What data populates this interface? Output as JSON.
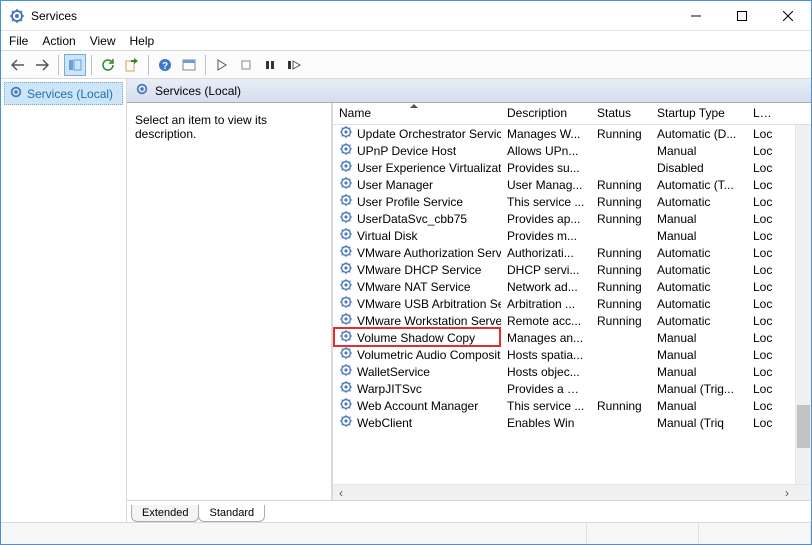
{
  "window": {
    "title": "Services"
  },
  "menu": {
    "file": "File",
    "action": "Action",
    "view": "View",
    "help": "Help"
  },
  "nav": {
    "root": "Services (Local)"
  },
  "pane": {
    "header": "Services (Local)",
    "desc_prompt": "Select an item to view its description."
  },
  "columns": {
    "name": "Name",
    "description": "Description",
    "status": "Status",
    "startup": "Startup Type",
    "logon": "Log"
  },
  "tabs": {
    "extended": "Extended",
    "standard": "Standard"
  },
  "highlight_index": 14,
  "services": [
    {
      "name": "Update Orchestrator Service",
      "desc": "Manages W...",
      "status": "Running",
      "startup": "Automatic (D...",
      "logon": "Loc"
    },
    {
      "name": "UPnP Device Host",
      "desc": "Allows UPn...",
      "status": "",
      "startup": "Manual",
      "logon": "Loc"
    },
    {
      "name": "User Experience Virtualizatio...",
      "desc": "Provides su...",
      "status": "",
      "startup": "Disabled",
      "logon": "Loc"
    },
    {
      "name": "User Manager",
      "desc": "User Manag...",
      "status": "Running",
      "startup": "Automatic (T...",
      "logon": "Loc"
    },
    {
      "name": "User Profile Service",
      "desc": "This service ...",
      "status": "Running",
      "startup": "Automatic",
      "logon": "Loc"
    },
    {
      "name": "UserDataSvc_cbb75",
      "desc": "Provides ap...",
      "status": "Running",
      "startup": "Manual",
      "logon": "Loc"
    },
    {
      "name": "Virtual Disk",
      "desc": "Provides m...",
      "status": "",
      "startup": "Manual",
      "logon": "Loc"
    },
    {
      "name": "VMware Authorization Servi...",
      "desc": "Authorizati...",
      "status": "Running",
      "startup": "Automatic",
      "logon": "Loc"
    },
    {
      "name": "VMware DHCP Service",
      "desc": "DHCP servi...",
      "status": "Running",
      "startup": "Automatic",
      "logon": "Loc"
    },
    {
      "name": "VMware NAT Service",
      "desc": "Network ad...",
      "status": "Running",
      "startup": "Automatic",
      "logon": "Loc"
    },
    {
      "name": "VMware USB Arbitration Ser...",
      "desc": "Arbitration ...",
      "status": "Running",
      "startup": "Automatic",
      "logon": "Loc"
    },
    {
      "name": "VMware Workstation Server",
      "desc": "Remote acc...",
      "status": "Running",
      "startup": "Automatic",
      "logon": "Loc"
    },
    {
      "name": "Volume Shadow Copy",
      "desc": "Manages an...",
      "status": "",
      "startup": "Manual",
      "logon": "Loc"
    },
    {
      "name": "Volumetric Audio Composit...",
      "desc": "Hosts spatia...",
      "status": "",
      "startup": "Manual",
      "logon": "Loc"
    },
    {
      "name": "WalletService",
      "desc": "Hosts objec...",
      "status": "",
      "startup": "Manual",
      "logon": "Loc"
    },
    {
      "name": "WarpJITSvc",
      "desc": "Provides a JI...",
      "status": "",
      "startup": "Manual (Trig...",
      "logon": "Loc"
    },
    {
      "name": "Web Account Manager",
      "desc": "This service ...",
      "status": "Running",
      "startup": "Manual",
      "logon": "Loc"
    },
    {
      "name": "WebClient",
      "desc": "Enables Win",
      "status": "",
      "startup": "Manual (Triq",
      "logon": "Loc"
    }
  ]
}
